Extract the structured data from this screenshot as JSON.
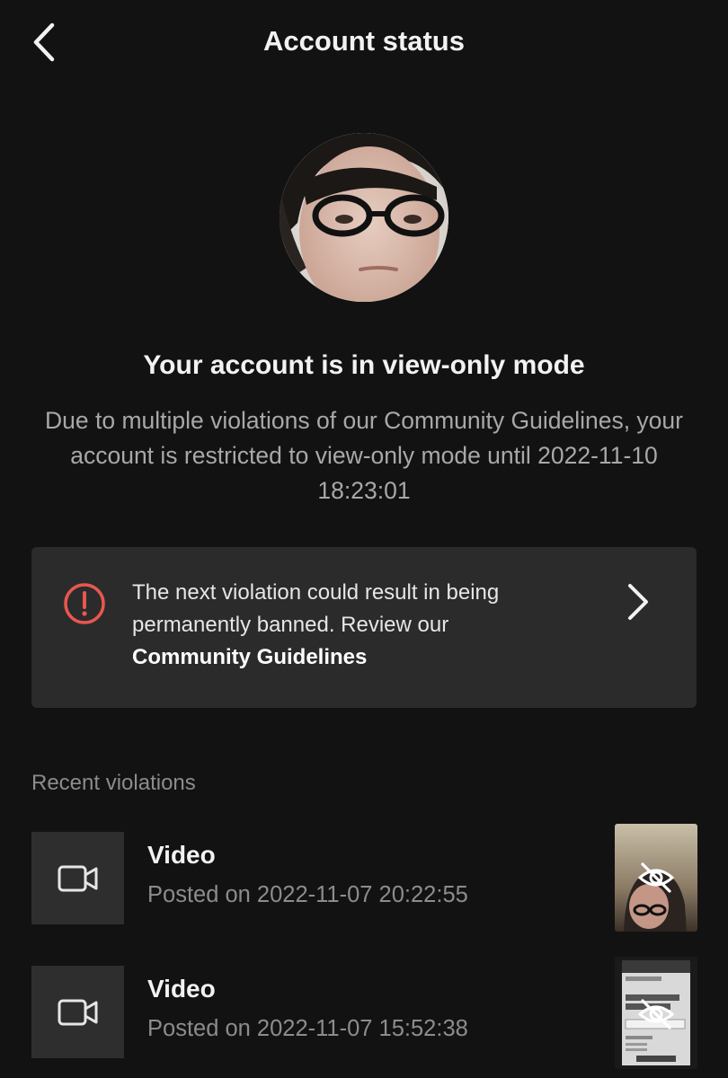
{
  "header": {
    "title": "Account status",
    "back_icon": "chevron-left-icon"
  },
  "status": {
    "heading": "Your account is in view-only mode",
    "description": "Due to multiple violations of our Community Guidelines, your account is restricted to view-only mode until 2022-11-10 18:23:01"
  },
  "warning": {
    "icon": "alert-circle-icon",
    "icon_color": "#e8574f",
    "text": "The next violation could result in being permanently banned. Review our",
    "link": "Community Guidelines",
    "chevron_icon": "chevron-right-icon"
  },
  "violations": {
    "section_title": "Recent violations",
    "items": [
      {
        "type": "Video",
        "posted": "Posted on 2022-11-07 20:22:55",
        "icon": "video-camera-icon",
        "thumb_icon": "eye-slash-icon"
      },
      {
        "type": "Video",
        "posted": "Posted on 2022-11-07 15:52:38",
        "icon": "video-camera-icon",
        "thumb_icon": "eye-slash-icon"
      }
    ]
  },
  "colors": {
    "background": "#121212",
    "card": "#2b2b2b",
    "muted_text": "#8c8c8c",
    "warning": "#e8574f"
  }
}
